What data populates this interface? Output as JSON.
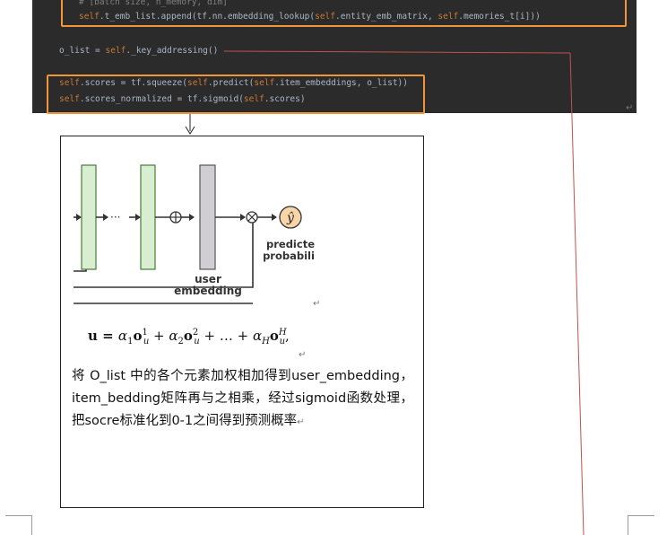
{
  "code": {
    "line1_comment": "# [batch size, n_memory, dim]",
    "line2": {
      "self1": "self",
      "mid1": ".t_emb_list.append(tf.nn.embedding_lookup(",
      "self2": "self",
      "mid2": ".entity_emb_matrix, ",
      "self3": "self",
      "mid3": ".memories_t[i]))"
    },
    "line3": {
      "pre": "o_list = ",
      "self1": "self",
      "post": "._key_addressing()"
    },
    "line4": {
      "self1": "self",
      "mid1": ".scores = tf.squeeze(",
      "self2": "self",
      "mid2": ".predict(",
      "self3": "self",
      "post": ".item_embeddings, o_list))"
    },
    "line5": {
      "self1": "self",
      "mid1": ".scores_normalized = tf.sigmoid(",
      "self2": "self",
      "post": ".scores)"
    }
  },
  "diagram": {
    "predict_label_1": "predicte",
    "predict_label_2": "probabili",
    "user_label_1": "user",
    "user_label_2": "embedding",
    "y_hat": "ŷ",
    "ellipsis": "···"
  },
  "formula": {
    "lhs": "u = ",
    "t1": "α",
    "t1_sub": "1",
    "o": "o",
    "t1_sup": "1",
    "u_sub": "u",
    "plus": " + ",
    "t2": "α",
    "t2_sub": "2",
    "t2_sup": "2",
    "dots": " + … + ",
    "tH": "α",
    "tH_sub": "H",
    "tH_sup": "H",
    "comma": ","
  },
  "description": "将 O_list 中的各个元素加权相加得到user_embedding，item_bedding矩阵再与之相乘，经过sigmoid函数处理，把socre标准化到0-1之间得到预测概率",
  "marks": {
    "return": "↵"
  },
  "colors": {
    "code_bg": "#2b2b2b",
    "highlight_box": "#f0953a",
    "keyword": "#cc7832",
    "connector_line": "#c0504d",
    "layer_green": "#d8eed0",
    "user_embedding_gray": "#d0ced3"
  }
}
